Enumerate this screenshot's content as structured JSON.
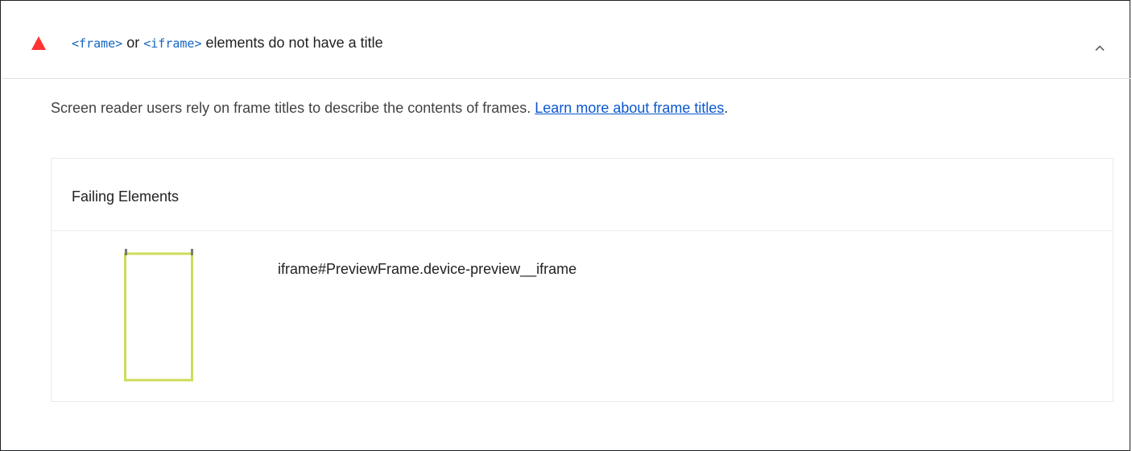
{
  "audit": {
    "code_frame": "<frame>",
    "or_text": " or ",
    "code_iframe": "<iframe>",
    "title_rest": " elements do not have a title",
    "status": "fail",
    "status_color": "#ff3333",
    "expand_icon": "chevron-up-icon"
  },
  "description": {
    "text": "Screen reader users rely on frame titles to describe the contents of frames. ",
    "link_text": "Learn more about frame titles",
    "trailing": "."
  },
  "table": {
    "header": "Failing Elements",
    "rows": [
      {
        "selector": "iframe#PreviewFrame.device-preview__iframe",
        "highlight_color": "#cddc5a"
      }
    ]
  }
}
